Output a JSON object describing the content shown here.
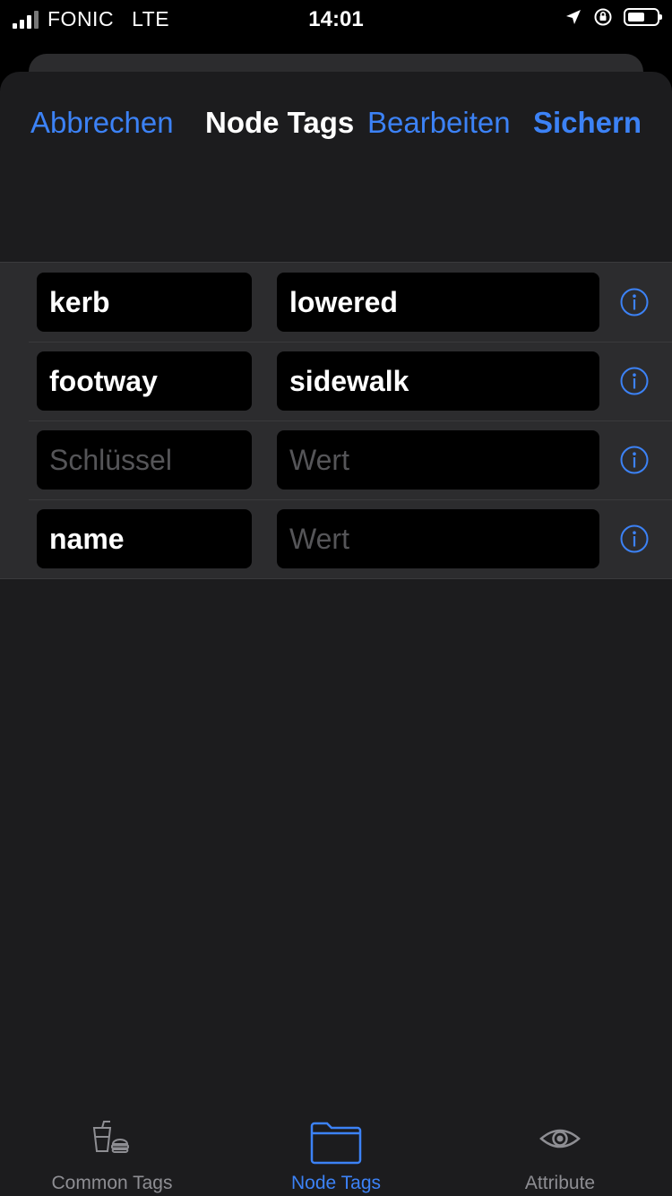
{
  "status_bar": {
    "carrier": "FONIC",
    "network": "LTE",
    "time": "14:01",
    "battery_level": 0.5,
    "icons": [
      "location-arrow-icon",
      "orientation-lock-icon",
      "battery-icon"
    ]
  },
  "nav": {
    "cancel_label": "Abbrechen",
    "title": "Node Tags",
    "edit_label": "Bearbeiten",
    "save_label": "Sichern"
  },
  "tags": [
    {
      "key": "kerb",
      "value": "lowered",
      "key_placeholder": "Schlüssel",
      "value_placeholder": "Wert"
    },
    {
      "key": "footway",
      "value": "sidewalk",
      "key_placeholder": "Schlüssel",
      "value_placeholder": "Wert"
    },
    {
      "key": "",
      "value": "",
      "key_placeholder": "Schlüssel",
      "value_placeholder": "Wert"
    },
    {
      "key": "name",
      "value": "",
      "key_placeholder": "Schlüssel",
      "value_placeholder": "Wert"
    }
  ],
  "tab_bar": {
    "items": [
      {
        "label": "Common Tags",
        "icon": "drink-burger-icon",
        "active": false
      },
      {
        "label": "Node Tags",
        "icon": "folder-icon",
        "active": true
      },
      {
        "label": "Attribute",
        "icon": "eye-icon",
        "active": false
      }
    ]
  },
  "colors": {
    "accent": "#3c82f6",
    "background": "#1c1c1e",
    "field_background": "#000000",
    "placeholder": "#555558"
  }
}
